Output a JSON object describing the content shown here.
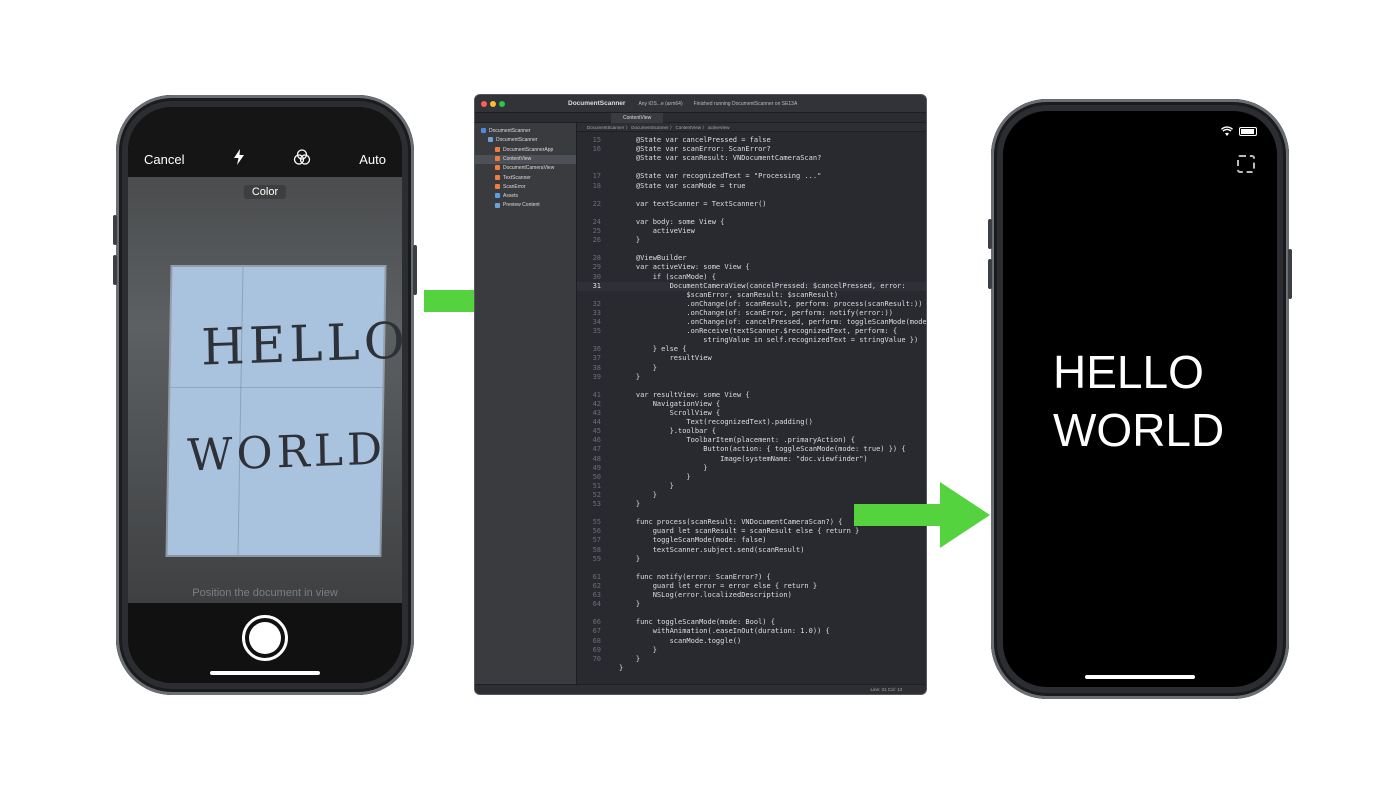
{
  "camera_screen": {
    "cancel_label": "Cancel",
    "flash_icon": "flash-icon",
    "filter_icon": "color-filter-icon",
    "auto_label": "Auto",
    "color_label": "Color",
    "handwriting_line1": "HELLO",
    "handwriting_line2": "WORLD",
    "hint_text": "Position the document in view",
    "shutter_icon": "shutter-button-icon"
  },
  "ide": {
    "window_title": "DocumentScanner",
    "window_subtitle": "master",
    "scheme": "Any iOS...e (arm64)",
    "status": "Finished running DocumentScanner on SE13A",
    "tab_label": "ContentView",
    "breadcrumb": "DocumentScanner 〉 DocumentScanner 〉 ContentView 〉 activeView",
    "navigator": [
      {
        "label": "DocumentScanner",
        "indent": 0,
        "kind": "project",
        "selected": false
      },
      {
        "label": "DocumentScanner",
        "indent": 1,
        "kind": "folder",
        "selected": false
      },
      {
        "label": "DocumentScannerApp",
        "indent": 2,
        "kind": "swift",
        "selected": false
      },
      {
        "label": "ContentView",
        "indent": 2,
        "kind": "swift",
        "selected": true
      },
      {
        "label": "DocumentCameraView",
        "indent": 2,
        "kind": "swift",
        "selected": false
      },
      {
        "label": "TextScanner",
        "indent": 2,
        "kind": "swift",
        "selected": false
      },
      {
        "label": "ScanError",
        "indent": 2,
        "kind": "swift",
        "selected": false
      },
      {
        "label": "Assets",
        "indent": 2,
        "kind": "asset",
        "selected": false
      },
      {
        "label": "Preview Content",
        "indent": 2,
        "kind": "folder",
        "selected": false
      }
    ],
    "filter_placeholder": "Filter",
    "cursor_position": "Line: 31  Col: 13",
    "code_lines": [
      {
        "n": "15",
        "t": "    @State var cancelPressed = false"
      },
      {
        "n": "16",
        "t": "    @State var scanError: ScanError?"
      },
      {
        "n": "",
        "t": "    @State var scanResult: VNDocumentCameraScan?"
      },
      {
        "n": "",
        "t": ""
      },
      {
        "n": "17",
        "t": "    @State var recognizedText = \"Processing ...\""
      },
      {
        "n": "18",
        "t": "    @State var scanMode = true"
      },
      {
        "n": "",
        "t": ""
      },
      {
        "n": "22",
        "t": "    var textScanner = TextScanner()"
      },
      {
        "n": "",
        "t": ""
      },
      {
        "n": "24",
        "t": "    var body: some View {"
      },
      {
        "n": "25",
        "t": "        activeView"
      },
      {
        "n": "26",
        "t": "    }"
      },
      {
        "n": "",
        "t": ""
      },
      {
        "n": "28",
        "t": "    @ViewBuilder"
      },
      {
        "n": "29",
        "t": "    var activeView: some View {"
      },
      {
        "n": "30",
        "t": "        if (scanMode) {"
      },
      {
        "n": "31",
        "t": "            DocumentCameraView(cancelPressed: $cancelPressed, error:"
      },
      {
        "n": "",
        "t": "                $scanError, scanResult: $scanResult)"
      },
      {
        "n": "32",
        "t": "                .onChange(of: scanResult, perform: process(scanResult:))"
      },
      {
        "n": "33",
        "t": "                .onChange(of: scanError, perform: notify(error:))"
      },
      {
        "n": "34",
        "t": "                .onChange(of: cancelPressed, perform: toggleScanMode(mode:))"
      },
      {
        "n": "35",
        "t": "                .onReceive(textScanner.$recognizedText, perform: {"
      },
      {
        "n": "",
        "t": "                    stringValue in self.recognizedText = stringValue })"
      },
      {
        "n": "36",
        "t": "        } else {"
      },
      {
        "n": "37",
        "t": "            resultView"
      },
      {
        "n": "38",
        "t": "        }"
      },
      {
        "n": "39",
        "t": "    }"
      },
      {
        "n": "",
        "t": ""
      },
      {
        "n": "41",
        "t": "    var resultView: some View {"
      },
      {
        "n": "42",
        "t": "        NavigationView {"
      },
      {
        "n": "43",
        "t": "            ScrollView {"
      },
      {
        "n": "44",
        "t": "                Text(recognizedText).padding()"
      },
      {
        "n": "45",
        "t": "            }.toolbar {"
      },
      {
        "n": "46",
        "t": "                ToolbarItem(placement: .primaryAction) {"
      },
      {
        "n": "47",
        "t": "                    Button(action: { toggleScanMode(mode: true) }) {"
      },
      {
        "n": "48",
        "t": "                        Image(systemName: \"doc.viewfinder\")"
      },
      {
        "n": "49",
        "t": "                    }"
      },
      {
        "n": "50",
        "t": "                }"
      },
      {
        "n": "51",
        "t": "            }"
      },
      {
        "n": "52",
        "t": "        }"
      },
      {
        "n": "53",
        "t": "    }"
      },
      {
        "n": "",
        "t": ""
      },
      {
        "n": "55",
        "t": "    func process(scanResult: VNDocumentCameraScan?) {"
      },
      {
        "n": "56",
        "t": "        guard let scanResult = scanResult else { return }"
      },
      {
        "n": "57",
        "t": "        toggleScanMode(mode: false)"
      },
      {
        "n": "58",
        "t": "        textScanner.subject.send(scanResult)"
      },
      {
        "n": "59",
        "t": "    }"
      },
      {
        "n": "",
        "t": ""
      },
      {
        "n": "61",
        "t": "    func notify(error: ScanError?) {"
      },
      {
        "n": "62",
        "t": "        guard let error = error else { return }"
      },
      {
        "n": "63",
        "t": "        NSLog(error.localizedDescription)"
      },
      {
        "n": "64",
        "t": "    }"
      },
      {
        "n": "",
        "t": ""
      },
      {
        "n": "66",
        "t": "    func toggleScanMode(mode: Bool) {"
      },
      {
        "n": "67",
        "t": "        withAnimation(.easeInOut(duration: 1.0)) {"
      },
      {
        "n": "68",
        "t": "            scanMode.toggle()"
      },
      {
        "n": "69",
        "t": "        }"
      },
      {
        "n": "70",
        "t": "    }"
      },
      {
        "n": "",
        "t": "}"
      }
    ],
    "highlight_line_index": 16
  },
  "result_screen": {
    "wifi_icon": "wifi-icon",
    "battery_icon": "battery-icon",
    "toolbar_icon": "doc-viewfinder-icon",
    "recognized_text": "HELLO\nWORLD"
  },
  "colors": {
    "arrow_green": "#55d33f",
    "ide_background": "#292a30",
    "paper_blue": "#a9c3df"
  }
}
